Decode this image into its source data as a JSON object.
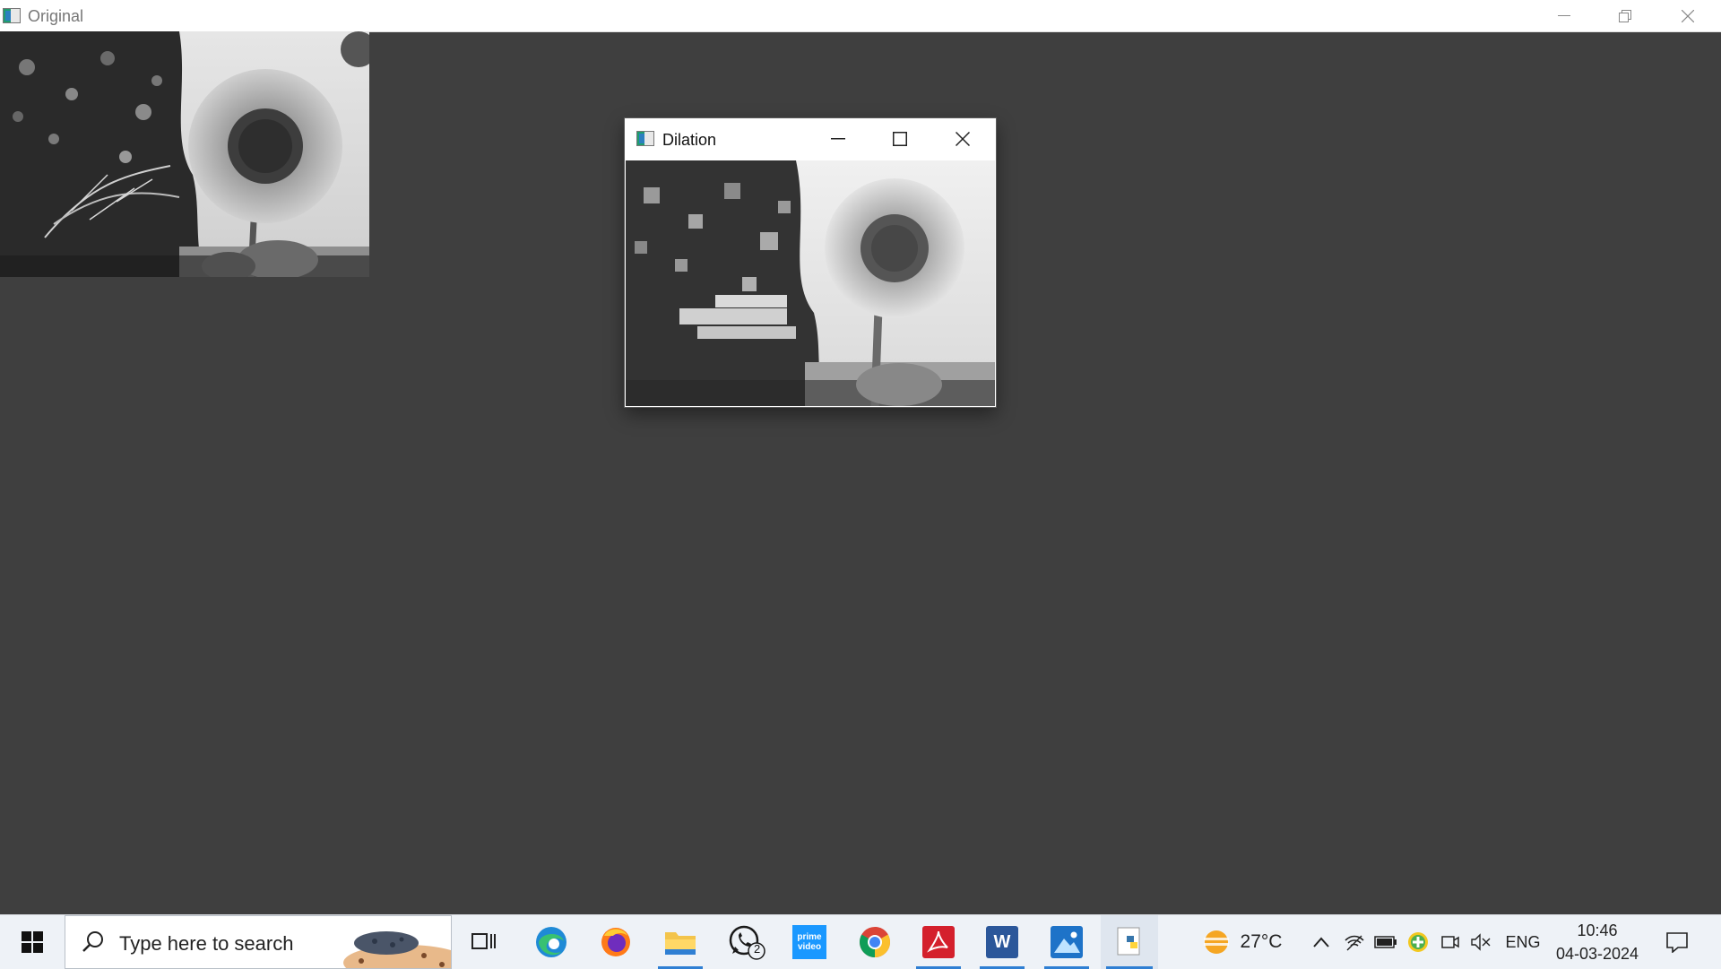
{
  "main_window": {
    "title": "Original",
    "icon": "opencv-window-icon",
    "controls": [
      "minimize-icon",
      "restore-icon",
      "close-icon"
    ]
  },
  "dilation_window": {
    "title": "Dilation",
    "icon": "opencv-window-icon",
    "controls": [
      "minimize-icon",
      "maximize-icon",
      "close-icon"
    ]
  },
  "taskbar": {
    "search_placeholder": "Type here to search",
    "apps": [
      {
        "name": "task-view",
        "icon": "task-view-icon"
      },
      {
        "name": "edge",
        "icon": "edge-icon"
      },
      {
        "name": "firefox",
        "icon": "firefox-icon"
      },
      {
        "name": "file-explorer",
        "icon": "folder-icon"
      },
      {
        "name": "whatsapp",
        "icon": "whatsapp-icon",
        "badge": "2"
      },
      {
        "name": "prime-video",
        "icon": "prime-video-icon",
        "label_line1": "prime",
        "label_line2": "video"
      },
      {
        "name": "chrome",
        "icon": "chrome-icon"
      },
      {
        "name": "acrobat",
        "icon": "acrobat-icon"
      },
      {
        "name": "word",
        "icon": "word-icon",
        "letter": "W"
      },
      {
        "name": "photos",
        "icon": "photos-icon"
      },
      {
        "name": "python",
        "icon": "python-icon"
      }
    ],
    "weather": {
      "temperature": "27°C",
      "icon": "weather-sun-icon"
    },
    "tray": {
      "language": "ENG",
      "time": "10:46",
      "date": "04-03-2024"
    }
  },
  "colors": {
    "desktop_bg": "#3f3f3f",
    "taskbar_bg": "#eef2f7",
    "running_indicator": "#2f7fd3"
  }
}
